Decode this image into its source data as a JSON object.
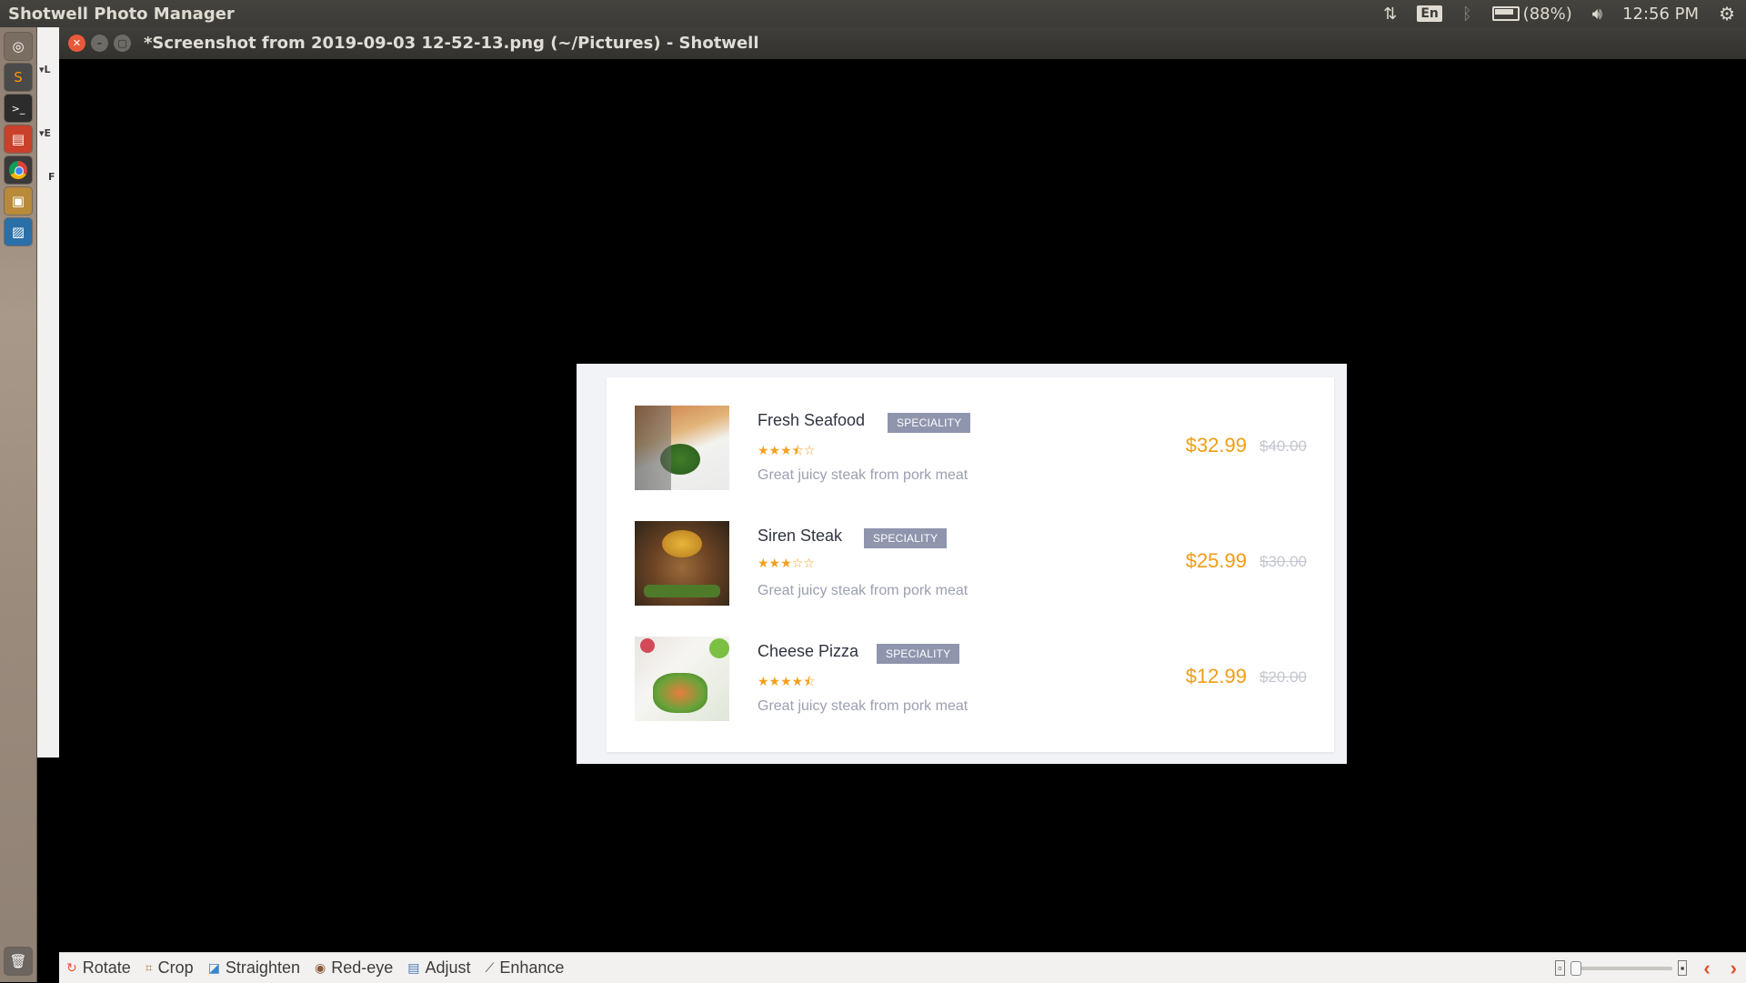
{
  "top_panel": {
    "app_title": "Shotwell Photo Manager",
    "keyboard_layout": "En",
    "battery": "(88%)",
    "clock": "12:56 PM"
  },
  "window": {
    "title": "*Screenshot from 2019-09-03 12-52-13.png (~/Pictures) - Shotwell"
  },
  "background_window": {
    "letters": [
      "L",
      "E",
      "F"
    ]
  },
  "menu": {
    "items": [
      {
        "name": "Fresh Seafood",
        "badge": "SPECIALITY",
        "stars": "★★★⯪☆",
        "description": "Great juicy steak from pork meat",
        "price": "$32.99",
        "old_price": "$40.00",
        "rating": 3.5
      },
      {
        "name": "Siren Steak",
        "badge": "SPECIALITY",
        "stars": "★★★☆☆",
        "description": "Great juicy steak from pork meat",
        "price": "$25.99",
        "old_price": "$30.00",
        "rating": 3
      },
      {
        "name": "Cheese Pizza",
        "badge": "SPECIALITY",
        "stars": "★★★★⯪",
        "description": "Great juicy steak from pork meat",
        "price": "$12.99",
        "old_price": "$20.00",
        "rating": 4.5
      }
    ]
  },
  "toolbar": {
    "rotate": "Rotate",
    "crop": "Crop",
    "straighten": "Straighten",
    "red_eye": "Red-eye",
    "adjust": "Adjust",
    "enhance": "Enhance",
    "zoom_level": 0
  },
  "colors": {
    "price": "#f09d14",
    "badge": "#8f95ad",
    "stars": "#f2a020",
    "close_button": "#e8593a"
  }
}
